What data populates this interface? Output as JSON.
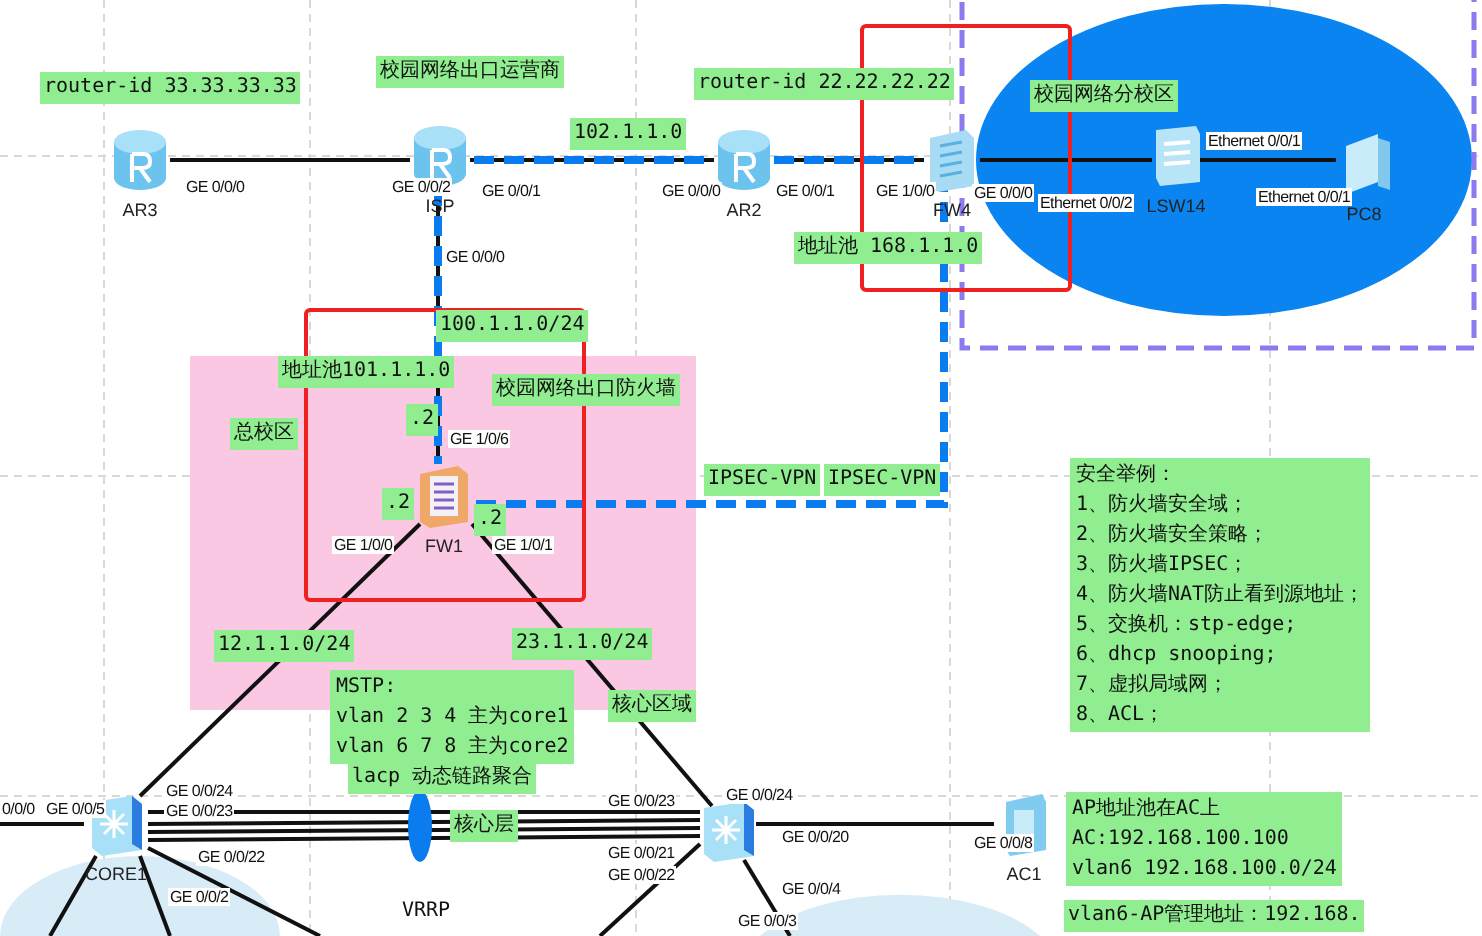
{
  "canvas": {
    "nodes": [
      {
        "kind": "router",
        "label": "AR3"
      },
      {
        "kind": "router",
        "label": "ISP"
      },
      {
        "kind": "router",
        "label": "AR2"
      },
      {
        "kind": "firewall",
        "label": "FW4"
      },
      {
        "kind": "switch",
        "label": "LSW14"
      },
      {
        "kind": "pc",
        "label": "PC8"
      },
      {
        "kind": "firewall-orange",
        "label": "FW1"
      },
      {
        "kind": "core-switch",
        "label": "CORE1"
      },
      {
        "kind": "core-switch"
      },
      {
        "kind": "ac",
        "label": "AC1"
      }
    ],
    "notes": [
      {
        "lines": [
          "router-id 33.33.33.33"
        ]
      },
      {
        "lines": [
          "校园网络出口运营商"
        ]
      },
      {
        "lines": [
          "102.1.1.0"
        ]
      },
      {
        "lines": [
          "router-id 22.22.22.22"
        ]
      },
      {
        "lines": [
          "校园网络分校区"
        ]
      },
      {
        "lines": [
          "地址池 168.1.1.0"
        ]
      },
      {
        "lines": [
          "100.1.1.0/24"
        ]
      },
      {
        "lines": [
          "地址池101.1.1.0"
        ]
      },
      {
        "lines": [
          "校园网络出口防火墙"
        ]
      },
      {
        "lines": [
          "总校区"
        ]
      },
      {
        "lines": [
          ".2"
        ]
      },
      {
        "lines": [
          ".2"
        ]
      },
      {
        "lines": [
          ".2"
        ]
      },
      {
        "lines": [
          "IPSEC-VPN"
        ]
      },
      {
        "lines": [
          "IPSEC-VPN"
        ]
      },
      {
        "lines": [
          "安全举例：",
          "1、防火墙安全域；",
          "2、防火墙安全策略；",
          "3、防火墙IPSEC；",
          "4、防火墙NAT防止看到源地址；",
          "5、交换机：stp-edge;",
          "6、dhcp snooping;",
          "7、虚拟局域网；",
          "8、ACL；"
        ]
      },
      {
        "lines": [
          "12.1.1.0/24"
        ]
      },
      {
        "lines": [
          "23.1.1.0/24"
        ]
      },
      {
        "lines": [
          "MSTP:",
          "vlan 2 3 4 主为core1",
          "vlan 6 7 8 主为core2"
        ]
      },
      {
        "lines": [
          "核心区域"
        ]
      },
      {
        "lines": [
          "lacp 动态链路聚合"
        ]
      },
      {
        "lines": [
          "核心层"
        ]
      },
      {
        "lines": [
          "AP地址池在AC上",
          "AC:192.168.100.100",
          "vlan6 192.168.100.0/24"
        ]
      },
      {
        "lines": [
          "vlan6-AP管理地址：192.168."
        ]
      }
    ],
    "ports": [
      "GE 0/0/0",
      "GE 0/0/2",
      "GE 0/0/1",
      "GE 0/0/0",
      "GE 0/0/1",
      "GE 1/0/0",
      "GE 0/0/0",
      "Ethernet 0/0/2",
      "Ethernet 0/0/1",
      "Ethernet 0/0/1",
      "GE 0/0/0",
      "GE 1/0/6",
      "GE 1/0/0",
      "GE 1/0/1",
      "0/0/0",
      "GE 0/0/5",
      "GE 0/0/24",
      "GE 0/0/23",
      "GE 0/0/22",
      "GE 0/0/2",
      "GE 0/0/24",
      "GE 0/0/23",
      "GE 0/0/21",
      "GE 0/0/22",
      "GE 0/0/20",
      "GE 0/0/4",
      "GE 0/0/3",
      "GE 0/0/8"
    ],
    "vrrp_label": "VRRP"
  }
}
